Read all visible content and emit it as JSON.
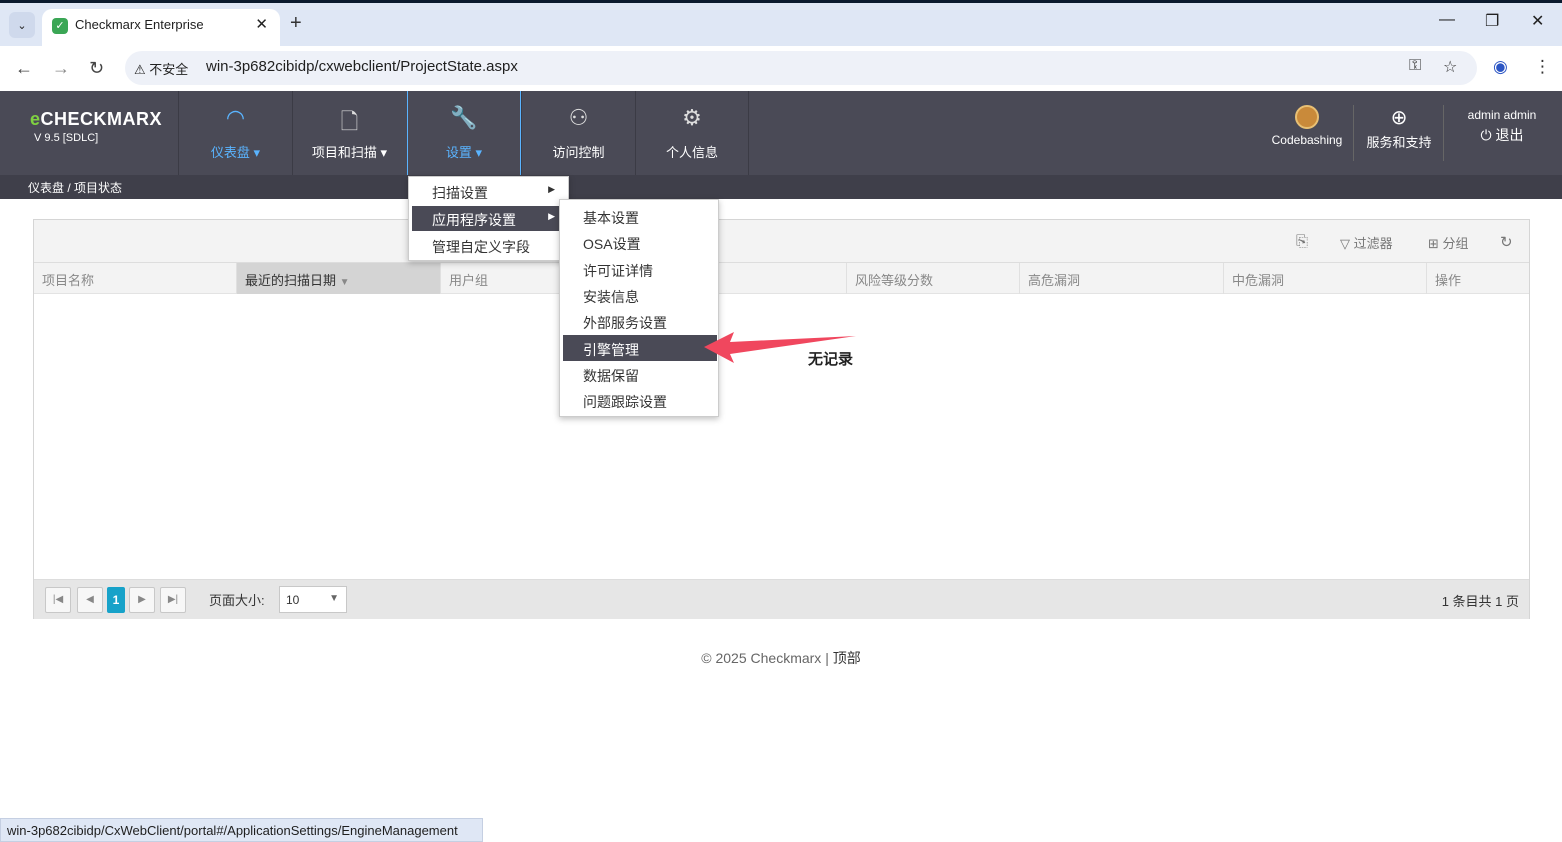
{
  "browser": {
    "tab_title": "Checkmarx Enterprise",
    "security_label": "不安全",
    "url": "win-3p682cibidp/cxwebclient/ProjectState.aspx",
    "status_url": "win-3p682cibidp/CxWebClient/portal#/ApplicationSettings/EngineManagement"
  },
  "app": {
    "logo": "CHECKMARX",
    "version": "V 9.5 [SDLC]",
    "nav": [
      {
        "label": "仪表盘"
      },
      {
        "label": "项目和扫描"
      },
      {
        "label": "设置"
      },
      {
        "label": "访问控制"
      },
      {
        "label": "个人信息"
      }
    ],
    "codebashing": "Codebashing",
    "support": "服务和支持",
    "user": "admin admin",
    "logout": "退出",
    "breadcrumb": "仪表盘 / 项目状态"
  },
  "settings_menu": {
    "items": [
      "扫描设置",
      "应用程序设置",
      "管理自定义字段"
    ]
  },
  "app_settings_submenu": {
    "items": [
      "基本设置",
      "OSA设置",
      "许可证详情",
      "安装信息",
      "外部服务设置",
      "引擎管理",
      "数据保留",
      "问题跟踪设置"
    ]
  },
  "grid": {
    "toolbar": {
      "filter": "过滤器",
      "group": "分组"
    },
    "columns": [
      "项目名称",
      "最近的扫描日期",
      "用户组",
      "风险等级分数",
      "高危漏洞",
      "中危漏洞",
      "操作"
    ],
    "empty_text": "无记录",
    "pager": {
      "current_page": "1",
      "page_size_label": "页面大小:",
      "page_size": "10",
      "summary": "1 条目共 1 页"
    }
  },
  "footer": {
    "copyright": "© 2025 Checkmarx |",
    "top_link": "顶部"
  },
  "colors": {
    "header_bg": "#4a4a56",
    "accent": "#5ab4ff",
    "pager_current": "#17a2c9",
    "annotation_arrow": "#f0475e"
  }
}
